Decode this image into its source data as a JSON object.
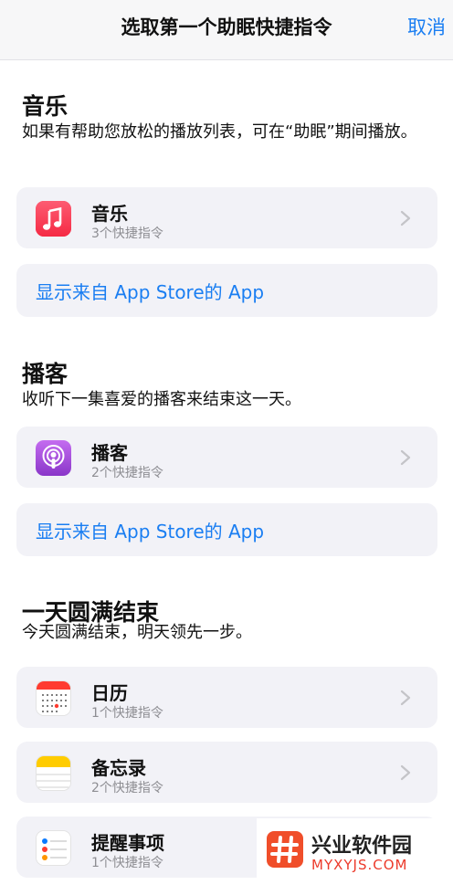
{
  "nav": {
    "title": "选取第一个助眠快捷指令",
    "cancel": "取消"
  },
  "sections": [
    {
      "title": "音乐",
      "subtitle": "如果有帮助您放松的播放列表，可在“助眠”期间播放。",
      "apps": [
        {
          "name": "音乐",
          "count": "3个快捷指令",
          "icon": "music-icon",
          "color": "#fb3a55"
        }
      ],
      "store_link": "显示来自 App Store的 App"
    },
    {
      "title": "播客",
      "subtitle": "收听下一集喜爱的播客来结束这一天。",
      "apps": [
        {
          "name": "播客",
          "count": "2个快捷指令",
          "icon": "podcasts-icon",
          "color": "#a24cdc"
        }
      ],
      "store_link": "显示来自 App Store的 App"
    },
    {
      "title": "一天圆满结束",
      "subtitle": "今天圆满结束，明天领先一步。",
      "apps": [
        {
          "name": "日历",
          "count": "1个快捷指令",
          "icon": "calendar-icon",
          "color": "#ff3b30"
        },
        {
          "name": "备忘录",
          "count": "2个快捷指令",
          "icon": "notes-icon",
          "color": "#ffcc00"
        },
        {
          "name": "提醒事项",
          "count": "1个快捷指令",
          "icon": "reminders-icon",
          "color": "#ffffff"
        }
      ]
    }
  ],
  "watermark": {
    "name": "兴业软件园",
    "url": "MYXYJS.COM",
    "logo_icon": "hash-logo-icon"
  }
}
